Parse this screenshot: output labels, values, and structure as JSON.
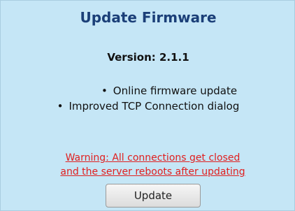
{
  "dialog": {
    "title": "Update Firmware",
    "version_label": "Version: 2.1.1",
    "features": [
      "Online firmware update",
      "Improved TCP Connection dialog"
    ],
    "warning_line1": "Warning: All connections get closed",
    "warning_line2": "and the server reboots after updating",
    "update_button_label": "Update"
  },
  "colors": {
    "background": "#c5e6f6",
    "title": "#1b3f78",
    "warning": "#e02020"
  }
}
